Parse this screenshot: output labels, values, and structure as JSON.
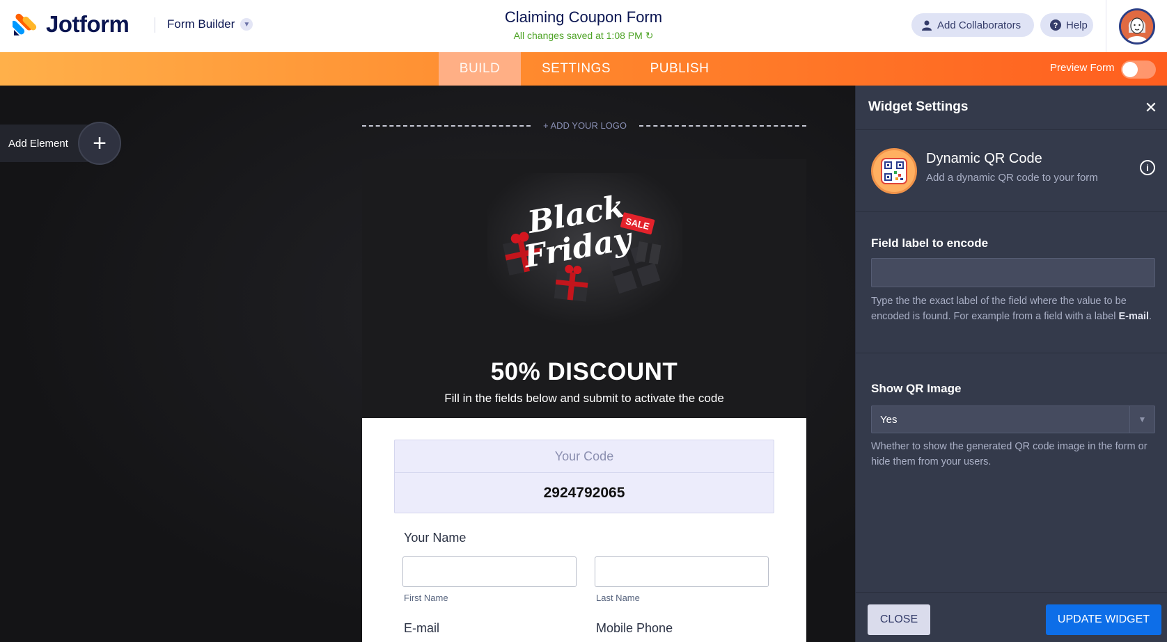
{
  "header": {
    "brand": "Jotform",
    "builder_menu_label": "Form Builder",
    "form_title": "Claiming Coupon Form",
    "saved_status": "All changes saved at 1:08 PM",
    "add_collaborators_label": "Add Collaborators",
    "help_label": "Help"
  },
  "nav": {
    "tabs": [
      {
        "label": "BUILD",
        "active": true
      },
      {
        "label": "SETTINGS",
        "active": false
      },
      {
        "label": "PUBLISH",
        "active": false
      }
    ],
    "preview_label": "Preview Form",
    "preview_enabled": false
  },
  "canvas": {
    "add_element_label": "Add Element",
    "add_logo_label": "+ ADD YOUR LOGO"
  },
  "form": {
    "hero_image_alt": "Black Friday SALE",
    "hero_text_line1": "Black",
    "hero_text_line2": "Friday",
    "hero_tag": "SALE",
    "discount_title": "50% DISCOUNT",
    "discount_subtitle": "Fill in the fields below and submit to activate the code",
    "code_label": "Your Code",
    "code_value": "2924792065",
    "name_label": "Your Name",
    "first_name_sublabel": "First Name",
    "last_name_sublabel": "Last Name",
    "email_label": "E-mail",
    "phone_label": "Mobile Phone"
  },
  "panel": {
    "title": "Widget Settings",
    "widget_name": "Dynamic QR Code",
    "widget_description": "Add a dynamic QR code to your form",
    "field_label_title": "Field label to encode",
    "field_label_value": "",
    "field_label_help_1": "Type the the exact label of the field where the value to be encoded is found. For example from a field with a label ",
    "field_label_help_bold": "E-mail",
    "field_label_help_2": ".",
    "show_qr_title": "Show QR Image",
    "show_qr_value": "Yes",
    "show_qr_help": "Whether to show the generated QR code image in the form or hide them from your users.",
    "close_label": "CLOSE",
    "update_label": "UPDATE WIDGET"
  },
  "colors": {
    "brand_navy": "#0a1551",
    "nav_orange_start": "#ffb04a",
    "nav_orange_end": "#ff5e1f",
    "saved_green": "#4da325",
    "panel_bg": "#343a4b",
    "update_blue": "#0d6ee8"
  },
  "icons": {
    "logo": "jotform-logo-icon",
    "chevron": "chevron-down-icon",
    "collaborator": "person-icon",
    "help": "help-circle-icon",
    "refresh": "refresh-icon",
    "add": "plus-icon",
    "close": "close-icon",
    "info": "info-icon",
    "widget": "qr-code-icon",
    "select_arrow": "caret-down-icon"
  }
}
